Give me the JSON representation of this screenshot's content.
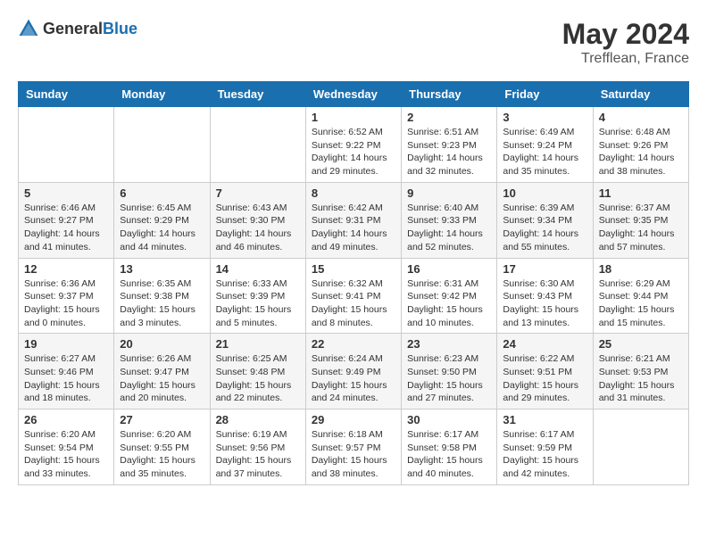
{
  "header": {
    "logo_general": "General",
    "logo_blue": "Blue",
    "month_title": "May 2024",
    "location": "Trefflean, France"
  },
  "days_of_week": [
    "Sunday",
    "Monday",
    "Tuesday",
    "Wednesday",
    "Thursday",
    "Friday",
    "Saturday"
  ],
  "weeks": [
    [
      {
        "day": "",
        "info": ""
      },
      {
        "day": "",
        "info": ""
      },
      {
        "day": "",
        "info": ""
      },
      {
        "day": "1",
        "info": "Sunrise: 6:52 AM\nSunset: 9:22 PM\nDaylight: 14 hours\nand 29 minutes."
      },
      {
        "day": "2",
        "info": "Sunrise: 6:51 AM\nSunset: 9:23 PM\nDaylight: 14 hours\nand 32 minutes."
      },
      {
        "day": "3",
        "info": "Sunrise: 6:49 AM\nSunset: 9:24 PM\nDaylight: 14 hours\nand 35 minutes."
      },
      {
        "day": "4",
        "info": "Sunrise: 6:48 AM\nSunset: 9:26 PM\nDaylight: 14 hours\nand 38 minutes."
      }
    ],
    [
      {
        "day": "5",
        "info": "Sunrise: 6:46 AM\nSunset: 9:27 PM\nDaylight: 14 hours\nand 41 minutes."
      },
      {
        "day": "6",
        "info": "Sunrise: 6:45 AM\nSunset: 9:29 PM\nDaylight: 14 hours\nand 44 minutes."
      },
      {
        "day": "7",
        "info": "Sunrise: 6:43 AM\nSunset: 9:30 PM\nDaylight: 14 hours\nand 46 minutes."
      },
      {
        "day": "8",
        "info": "Sunrise: 6:42 AM\nSunset: 9:31 PM\nDaylight: 14 hours\nand 49 minutes."
      },
      {
        "day": "9",
        "info": "Sunrise: 6:40 AM\nSunset: 9:33 PM\nDaylight: 14 hours\nand 52 minutes."
      },
      {
        "day": "10",
        "info": "Sunrise: 6:39 AM\nSunset: 9:34 PM\nDaylight: 14 hours\nand 55 minutes."
      },
      {
        "day": "11",
        "info": "Sunrise: 6:37 AM\nSunset: 9:35 PM\nDaylight: 14 hours\nand 57 minutes."
      }
    ],
    [
      {
        "day": "12",
        "info": "Sunrise: 6:36 AM\nSunset: 9:37 PM\nDaylight: 15 hours\nand 0 minutes."
      },
      {
        "day": "13",
        "info": "Sunrise: 6:35 AM\nSunset: 9:38 PM\nDaylight: 15 hours\nand 3 minutes."
      },
      {
        "day": "14",
        "info": "Sunrise: 6:33 AM\nSunset: 9:39 PM\nDaylight: 15 hours\nand 5 minutes."
      },
      {
        "day": "15",
        "info": "Sunrise: 6:32 AM\nSunset: 9:41 PM\nDaylight: 15 hours\nand 8 minutes."
      },
      {
        "day": "16",
        "info": "Sunrise: 6:31 AM\nSunset: 9:42 PM\nDaylight: 15 hours\nand 10 minutes."
      },
      {
        "day": "17",
        "info": "Sunrise: 6:30 AM\nSunset: 9:43 PM\nDaylight: 15 hours\nand 13 minutes."
      },
      {
        "day": "18",
        "info": "Sunrise: 6:29 AM\nSunset: 9:44 PM\nDaylight: 15 hours\nand 15 minutes."
      }
    ],
    [
      {
        "day": "19",
        "info": "Sunrise: 6:27 AM\nSunset: 9:46 PM\nDaylight: 15 hours\nand 18 minutes."
      },
      {
        "day": "20",
        "info": "Sunrise: 6:26 AM\nSunset: 9:47 PM\nDaylight: 15 hours\nand 20 minutes."
      },
      {
        "day": "21",
        "info": "Sunrise: 6:25 AM\nSunset: 9:48 PM\nDaylight: 15 hours\nand 22 minutes."
      },
      {
        "day": "22",
        "info": "Sunrise: 6:24 AM\nSunset: 9:49 PM\nDaylight: 15 hours\nand 24 minutes."
      },
      {
        "day": "23",
        "info": "Sunrise: 6:23 AM\nSunset: 9:50 PM\nDaylight: 15 hours\nand 27 minutes."
      },
      {
        "day": "24",
        "info": "Sunrise: 6:22 AM\nSunset: 9:51 PM\nDaylight: 15 hours\nand 29 minutes."
      },
      {
        "day": "25",
        "info": "Sunrise: 6:21 AM\nSunset: 9:53 PM\nDaylight: 15 hours\nand 31 minutes."
      }
    ],
    [
      {
        "day": "26",
        "info": "Sunrise: 6:20 AM\nSunset: 9:54 PM\nDaylight: 15 hours\nand 33 minutes."
      },
      {
        "day": "27",
        "info": "Sunrise: 6:20 AM\nSunset: 9:55 PM\nDaylight: 15 hours\nand 35 minutes."
      },
      {
        "day": "28",
        "info": "Sunrise: 6:19 AM\nSunset: 9:56 PM\nDaylight: 15 hours\nand 37 minutes."
      },
      {
        "day": "29",
        "info": "Sunrise: 6:18 AM\nSunset: 9:57 PM\nDaylight: 15 hours\nand 38 minutes."
      },
      {
        "day": "30",
        "info": "Sunrise: 6:17 AM\nSunset: 9:58 PM\nDaylight: 15 hours\nand 40 minutes."
      },
      {
        "day": "31",
        "info": "Sunrise: 6:17 AM\nSunset: 9:59 PM\nDaylight: 15 hours\nand 42 minutes."
      },
      {
        "day": "",
        "info": ""
      }
    ]
  ]
}
